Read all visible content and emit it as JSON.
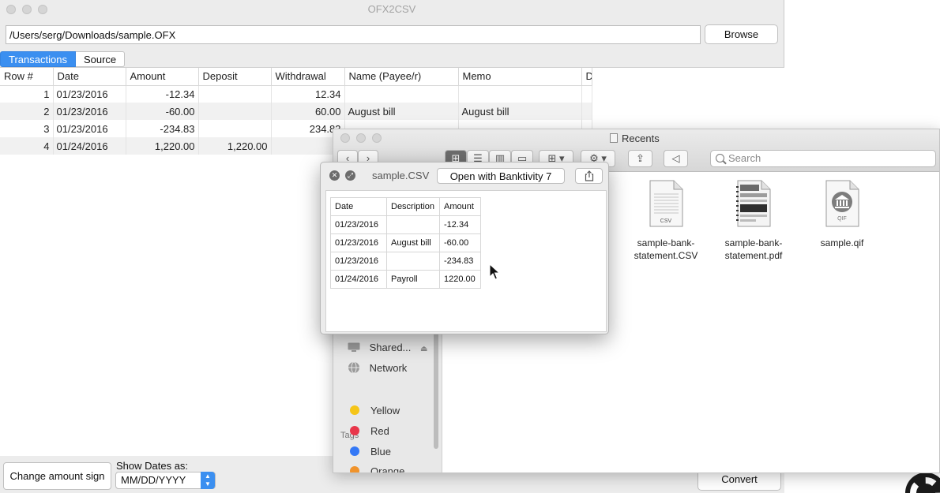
{
  "main_window": {
    "title": "OFX2CSV",
    "path_value": "/Users/serg/Downloads/sample.OFX",
    "browse_label": "Browse",
    "tabs": [
      {
        "label": "Transactions",
        "active": true
      },
      {
        "label": "Source",
        "active": false
      }
    ],
    "table": {
      "columns": [
        "Row #",
        "Date",
        "Amount",
        "Deposit",
        "Withdrawal",
        "Name (Payee/r)",
        "Memo",
        "D"
      ],
      "rows": [
        {
          "row": "1",
          "date": "01/23/2016",
          "amount": "-12.34",
          "deposit": "",
          "withdrawal": "12.34",
          "name": "",
          "memo": ""
        },
        {
          "row": "2",
          "date": "01/23/2016",
          "amount": "-60.00",
          "deposit": "",
          "withdrawal": "60.00",
          "name": "August bill",
          "memo": "August bill"
        },
        {
          "row": "3",
          "date": "01/23/2016",
          "amount": "-234.83",
          "deposit": "",
          "withdrawal": "234.83",
          "name": "",
          "memo": ""
        },
        {
          "row": "4",
          "date": "01/24/2016",
          "amount": "1,220.00",
          "deposit": "1,220.00",
          "withdrawal": "",
          "name": "",
          "memo": ""
        }
      ]
    },
    "change_sign_label": "Change amount sign",
    "show_dates_label": "Show Dates as:",
    "date_format_value": "MM/DD/YYYY",
    "convert_label": "Convert"
  },
  "finder": {
    "title": "Recents",
    "search_placeholder": "Search",
    "sidebar": {
      "shared_label": "Shared...",
      "network_label": "Network",
      "tags_header": "Tags",
      "tags": [
        {
          "label": "Yellow",
          "color": "#f5c518"
        },
        {
          "label": "Red",
          "color": "#e8364a"
        },
        {
          "label": "Blue",
          "color": "#3478f6"
        },
        {
          "label": "Orange",
          "color": "#f0932b"
        }
      ]
    },
    "files": [
      {
        "name_line1": "sample-bank-",
        "name_line2": "statement.CSV",
        "badge": "CSV",
        "icon": "csv-file-icon"
      },
      {
        "name_line1": "sample-bank-",
        "name_line2": "statement.pdf",
        "badge": "",
        "icon": "pdf-file-icon"
      },
      {
        "name_line1": "sample.qif",
        "name_line2": "",
        "badge": "QIF",
        "icon": "qif-file-icon"
      }
    ]
  },
  "quicklook": {
    "title": "sample.CSV",
    "open_with_label": "Open with Banktivity 7",
    "csv": {
      "columns": [
        "Date",
        "Description",
        "Amount"
      ],
      "rows": [
        [
          "01/23/2016",
          "",
          "-12.34"
        ],
        [
          "01/23/2016",
          "August bill",
          "-60.00"
        ],
        [
          "01/23/2016",
          "",
          "-234.83"
        ],
        [
          "01/24/2016",
          "Payroll",
          "1220.00"
        ]
      ]
    }
  },
  "colors": {
    "accent": "#3b8ff0",
    "window_bg": "#ececec"
  }
}
